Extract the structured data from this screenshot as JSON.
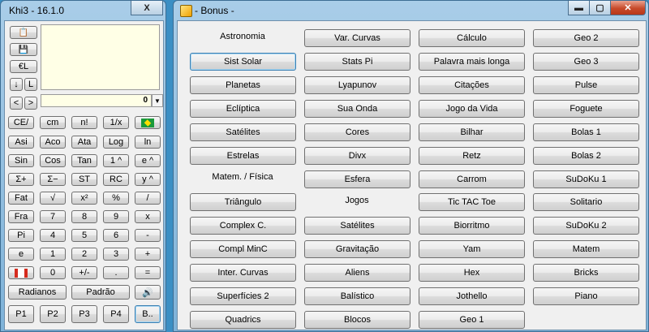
{
  "calc_window": {
    "title": "Khi3 - 16.1.0",
    "close_glyph": "X",
    "number_display": "0",
    "tool_buttons": {
      "a": "📋",
      "b": "💾",
      "c": "€L",
      "down": "↓",
      "l": "L",
      "prev": "<",
      "next": ">"
    },
    "keys": {
      "r1": [
        "CE/",
        "cm",
        "n!",
        "1/x"
      ],
      "r2": [
        "Asi",
        "Aco",
        "Ata",
        "Log",
        "ln"
      ],
      "r3": [
        "Sin",
        "Cos",
        "Tan",
        "1 ^",
        "e ^"
      ],
      "r4": [
        "Σ+",
        "Σ−",
        "ST",
        "RC",
        "y ^"
      ],
      "r5": [
        "Fat",
        "√",
        "x²",
        "%",
        "/"
      ],
      "r6": [
        "Fra",
        "7",
        "8",
        "9",
        "x"
      ],
      "r7": [
        "Pi",
        "4",
        "5",
        "6",
        "-"
      ],
      "r8": [
        "e",
        "1",
        "2",
        "3",
        "+"
      ],
      "r9": [
        "0",
        "+/-",
        ".",
        "="
      ]
    },
    "mode_buttons": {
      "radianos": "Radianos",
      "padrao": "Padrão"
    },
    "program_buttons": [
      "P1",
      "P2",
      "P3",
      "P4",
      "B.."
    ]
  },
  "bonus_window": {
    "title": "- Bonus -",
    "col1": {
      "heading_astronomia": "Astronomia",
      "items1": [
        "Sist Solar",
        "Planetas",
        "Eclíptica",
        "Satélites",
        "Estrelas"
      ],
      "heading_matem": "Matem. / Física",
      "items2": [
        "Triângulo",
        "Complex C.",
        "Compl MinC",
        "Inter. Curvas",
        "Superfícies 2",
        "Quadrics"
      ]
    },
    "col2": {
      "items1": [
        "Var. Curvas",
        "Stats Pi",
        "Lyapunov",
        "Sua Onda",
        "Cores",
        "Divx",
        "Esfera"
      ],
      "heading_jogos": "Jogos",
      "items2": [
        "Satélites",
        "Gravitação",
        "Aliens",
        "Balístico",
        "Blocos"
      ]
    },
    "col3": {
      "items": [
        "Cálculo",
        "Palavra mais longa",
        "Citações",
        "Jogo da Vida",
        "Bilhar",
        "Retz",
        "Carrom",
        "Tic TAC Toe",
        "Biorritmo",
        "Yam",
        "Hex",
        "Jothello",
        "Geo 1"
      ]
    },
    "col4": {
      "items": [
        "Geo 2",
        "Geo 3",
        "Pulse",
        "Foguete",
        "Bolas 1",
        "Bolas 2",
        "SuDoKu 1",
        "Solitario",
        "SuDoKu 2",
        "Matem",
        "Bricks",
        "Piano"
      ]
    }
  }
}
